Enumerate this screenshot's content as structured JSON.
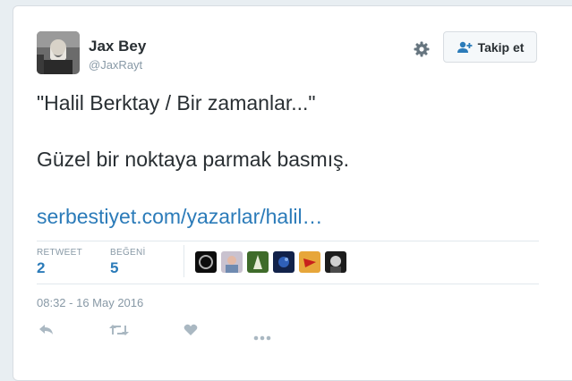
{
  "user": {
    "name": "Jax Bey",
    "handle": "@JaxRayt"
  },
  "follow_button": {
    "label": "Takip et"
  },
  "tweet": {
    "line1": "\"Halil Berktay / Bir zamanlar...\"",
    "line2": "Güzel bir noktaya parmak basmış.",
    "link": "serbestiyet.com/yazarlar/halil…"
  },
  "stats": {
    "retweet_label": "RETWEET",
    "retweet_count": "2",
    "likes_label": "BEĞENİ",
    "likes_count": "5"
  },
  "timestamp": "08:32 - 16 May 2016",
  "icons": {
    "settings": "gear-icon",
    "follow": "add-user-icon",
    "reply": "reply-icon",
    "retweet": "retweet-icon",
    "like": "heart-icon",
    "more": "more-icon"
  },
  "colors": {
    "link": "#2b7bb9",
    "text": "#292f33",
    "muted": "#8899a6",
    "action": "#aab8c2"
  }
}
